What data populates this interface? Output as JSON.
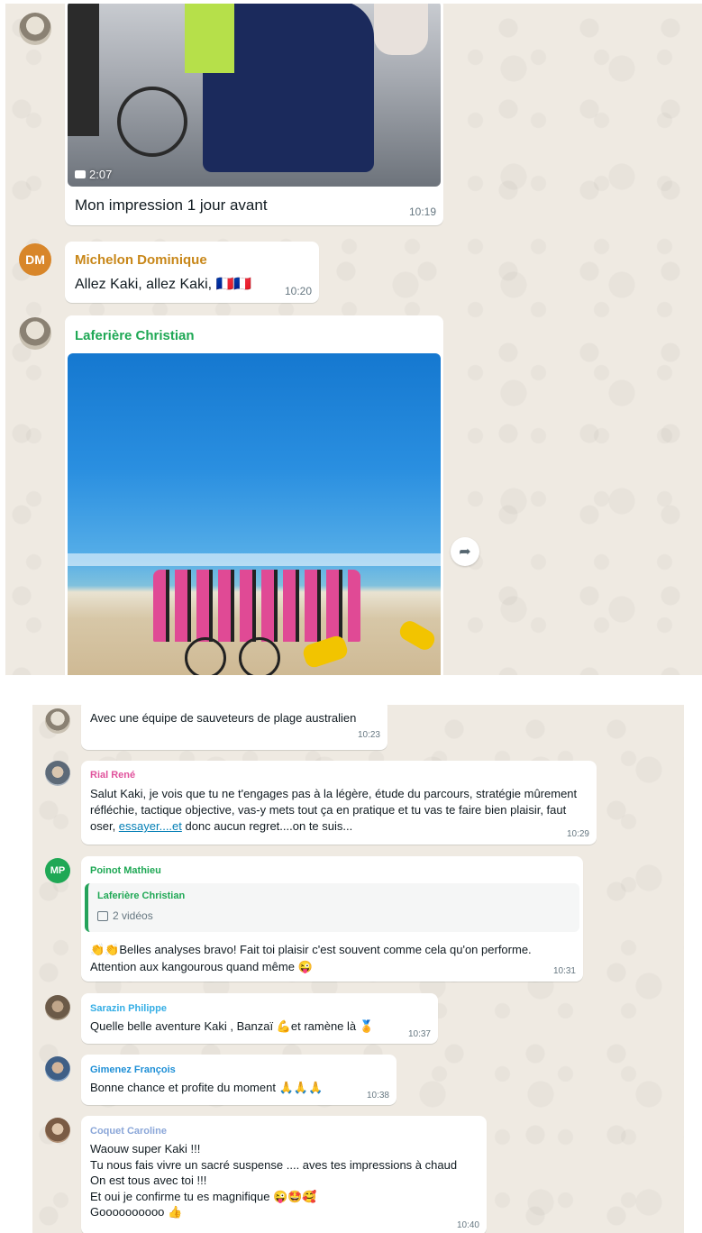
{
  "top": {
    "video_message": {
      "duration": "2:07",
      "caption": "Mon impression 1 jour avant",
      "time": "10:19"
    },
    "michelon": {
      "initials": "DM",
      "sender": "Michelon Dominique",
      "text": "Allez Kaki, allez Kaki, 🇫🇷🇫🇷",
      "time": "10:20"
    },
    "laferiere": {
      "sender": "Laferière Christian"
    },
    "forward_icon": "forward-icon",
    "colors": {
      "green_sender": "#1fa855",
      "orange_sender": "#c88719",
      "avatar_orange": "#d8862a"
    }
  },
  "bottom": {
    "caption_msg": {
      "text": "Avec une équipe de sauveteurs de plage australien",
      "time": "10:23"
    },
    "rial": {
      "sender": "Rial René",
      "text_before": "Salut Kaki, je vois que tu ne t'engages pas à la légère, étude du parcours, stratégie mûrement réfléchie, tactique objective, vas-y mets tout ça en pratique et tu vas te faire bien plaisir, faut oser, ",
      "link": "essayer....et",
      "text_after": " donc aucun regret....on te suis...",
      "time": "10:29"
    },
    "poinot": {
      "initials": "MP",
      "sender": "Poinot Mathieu",
      "quote_sender": "Laferière Christian",
      "quote_text": "2 vidéos",
      "text": "👏👏Belles analyses bravo! Fait toi plaisir c'est souvent comme cela qu'on performe. Attention aux kangourous quand même 😜",
      "time": "10:31"
    },
    "sarazin": {
      "sender": "Sarazin Philippe",
      "text": "Quelle belle aventure Kaki , Banzaï 💪et ramène là 🏅",
      "time": "10:37"
    },
    "gimenez": {
      "sender": "Gimenez François",
      "text": "Bonne chance et profite du moment 🙏🙏🙏",
      "time": "10:38"
    },
    "coquet": {
      "sender": "Coquet Caroline",
      "lines": [
        "Waouw super Kaki !!!",
        "Tu nous fais vivre un sacré suspense .... aves tes impressions à chaud",
        "On est tous avec toi !!!",
        "Et oui je confirme tu es magnifique 😜🤩🥰",
        "Goooooooooo 👍"
      ],
      "time": "10:40"
    },
    "colors": {
      "rial": "#e0529c",
      "poinot": "#1fa855",
      "sarazin": "#35aee5",
      "gimenez": "#1e8fd6",
      "coquet": "#8aa6d8"
    }
  }
}
